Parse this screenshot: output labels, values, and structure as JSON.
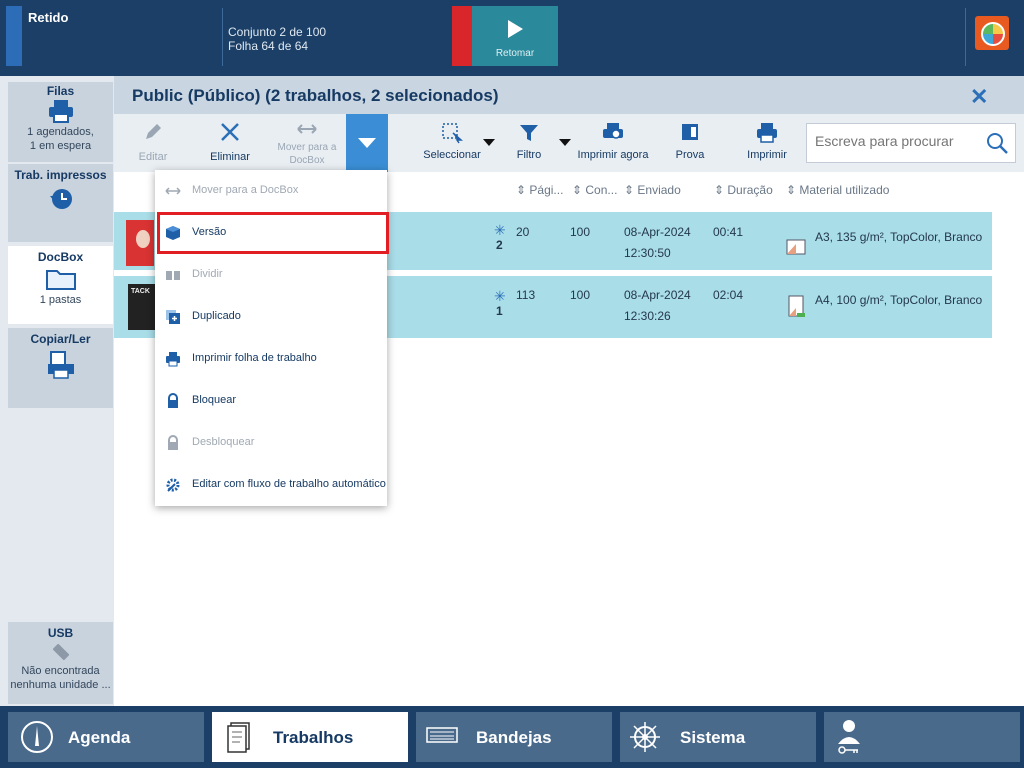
{
  "top": {
    "status": "Retido",
    "set_line": "Conjunto 2 de 100",
    "sheet_line": "Folha 64 de 64",
    "resume": "Retomar"
  },
  "sidebar": {
    "queues": {
      "title": "Filas",
      "line1": "1 agendados,",
      "line2": "1 em espera"
    },
    "printed": {
      "title": "Trab. impressos"
    },
    "docbox": {
      "title": "DocBox",
      "sub": "1 pastas"
    },
    "copy": {
      "title": "Copiar/Ler"
    },
    "usb": {
      "title": "USB",
      "line1": "Não encontrada",
      "line2": "nenhuma unidade ..."
    }
  },
  "main": {
    "title": "Public (Público) (2 trabalhos, 2 selecionados)"
  },
  "toolbar": {
    "edit": "Editar",
    "delete": "Eliminar",
    "move": "Mover para a DocBox",
    "select": "Seleccionar",
    "filter": "Filtro",
    "print_now": "Imprimir agora",
    "proof": "Prova",
    "print": "Imprimir",
    "search_placeholder": "Escreva para procurar"
  },
  "columns": {
    "pages": "Pági...",
    "copies": "Con...",
    "sent": "Enviado",
    "duration": "Duração",
    "media": "Material utilizado"
  },
  "jobs": [
    {
      "count": "2",
      "pages": "20",
      "copies": "100",
      "date": "08-Apr-2024",
      "time": "12:30:50",
      "duration": "00:41",
      "media": "A3, 135 g/m², TopColor, Branco"
    },
    {
      "count": "1",
      "pages": "113",
      "copies": "100",
      "date": "08-Apr-2024",
      "time": "12:30:26",
      "duration": "02:04",
      "media": "A4, 100 g/m², TopColor, Branco"
    }
  ],
  "menu": [
    "Mover para a DocBox",
    "Versão",
    "Dividir",
    "Duplicado",
    "Imprimir folha de trabalho",
    "Bloquear",
    "Desbloquear",
    "Editar com fluxo de trabalho automático"
  ],
  "nav": {
    "schedule": "Agenda",
    "jobs": "Trabalhos",
    "trays": "Bandejas",
    "system": "Sistema"
  },
  "colors": {
    "accent": "#3b8ed5",
    "selected_row": "#a9dde8",
    "highlight": "#e01e23",
    "header": "#1b3f66"
  }
}
